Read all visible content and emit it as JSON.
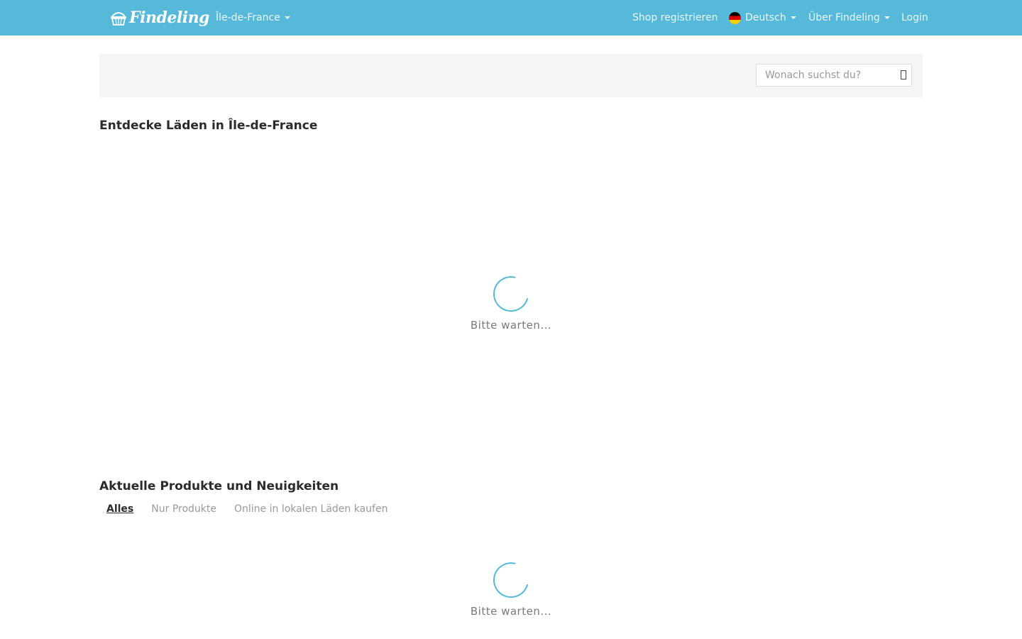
{
  "navbar": {
    "brand": "Findeling",
    "region": "Île-de-France",
    "register_shop": "Shop registrieren",
    "language": "Deutsch",
    "about": "Über Findeling",
    "login": "Login"
  },
  "search": {
    "placeholder": "Wonach suchst du?"
  },
  "discover": {
    "title": "Entdecke Läden in Île-de-France",
    "loading_text": "Bitte warten..."
  },
  "news": {
    "title": "Aktuelle Produkte und Neuigkeiten",
    "tabs": [
      {
        "label": "Alles",
        "active": true
      },
      {
        "label": "Nur Produkte",
        "active": false
      },
      {
        "label": "Online in lokalen Läden kaufen",
        "active": false
      }
    ],
    "loading_text": "Bitte warten..."
  },
  "colors": {
    "navbar": "#56b9d9",
    "spinner": "#56b9d9"
  },
  "icons": {
    "brand": "basket-icon",
    "language": "german-flag-icon",
    "search": "search-icon"
  }
}
